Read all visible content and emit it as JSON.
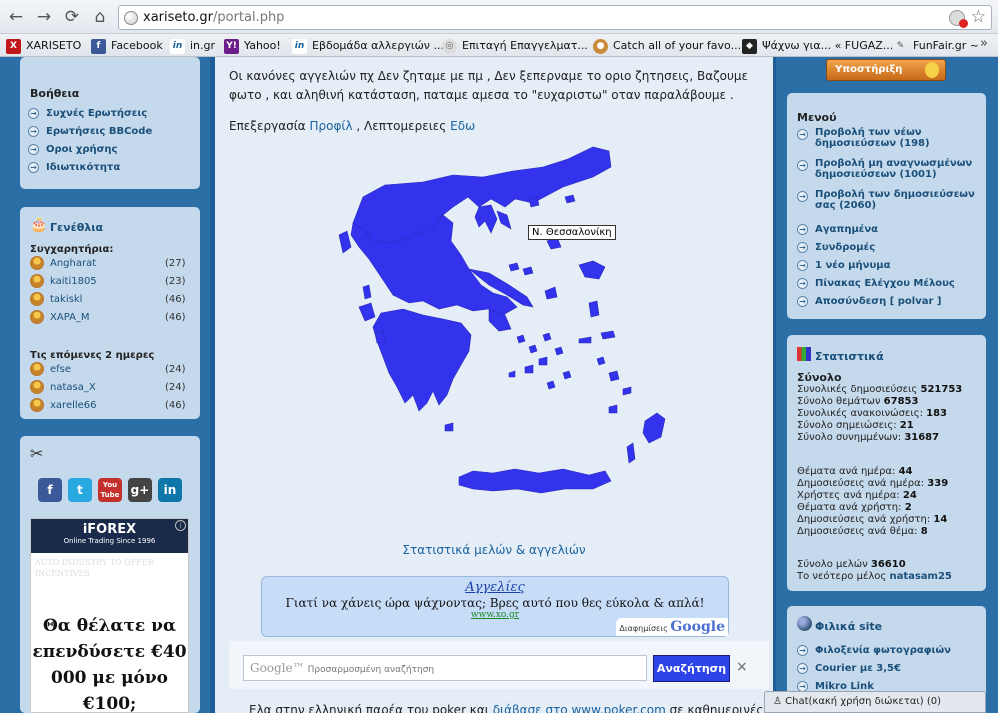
{
  "browser": {
    "url_host": "xariseto.gr",
    "url_path": "/portal.php",
    "bookmarks": [
      {
        "label": "XARISETO",
        "icon": "xariseto-icon"
      },
      {
        "label": "Facebook",
        "icon": "facebook-icon"
      },
      {
        "label": "in.gr",
        "icon": "in-gr-icon"
      },
      {
        "label": "Yahoo!",
        "icon": "yahoo-icon"
      },
      {
        "label": "Εβδομάδα αλλεργιών ...",
        "icon": "in-gr-icon"
      },
      {
        "label": "Επιταγή Επαγγελματ...",
        "icon": "globe-icon"
      },
      {
        "label": "Catch all of your favo...",
        "icon": "cookie-icon"
      },
      {
        "label": "Ψάχνω για... « FUGAZ...",
        "icon": "fugaz-icon"
      },
      {
        "label": "FunFair.gr ~",
        "icon": "funfair-icon"
      }
    ],
    "more": "»"
  },
  "left": {
    "help": {
      "title": "Βοήθεια",
      "items": [
        "Συχνές Ερωτήσεις",
        "Ερωτήσεις BBCode",
        "Οροι χρήσης",
        "Ιδιωτικότητα"
      ]
    },
    "birthdays": {
      "title": "Γενέθλια",
      "congrats_label": "Συγχαρητήρια:",
      "today": [
        {
          "name": "Angharat",
          "count": "(27)"
        },
        {
          "name": "kaiti1805",
          "count": "(23)"
        },
        {
          "name": "takiskl",
          "count": "(46)"
        },
        {
          "name": "XAPA_M",
          "count": "(46)"
        }
      ],
      "next_label": "Τις επόμενες 2 ημερες",
      "upcoming": [
        {
          "name": "efse",
          "count": "(24)"
        },
        {
          "name": "natasa_X",
          "count": "(24)"
        },
        {
          "name": "xarelle66",
          "count": "(46)"
        }
      ]
    },
    "social": [
      "f",
      "t",
      "You\nTube",
      "g+",
      "in"
    ],
    "ad": {
      "logo": "iFOREX",
      "tagline": "Online Trading Since 1996",
      "bg_text": "AUTO INDUSTRY TO OFFER INCENTIVES",
      "text": "Θα θέλατε να επενδύσετε €40 000 με μόνο €100;"
    }
  },
  "center": {
    "rules_text": "Οι κανόνες αγγελιών πχ Δεν ζηταμε με πμ , Δεν ξεπερναμε το οριο ζητησεις, Βαζουμε φωτο , και αληθινή κατάσταση, παταμε αμεσα το \"ευχαριστω\" οταν παραλάβουμε .",
    "edit_prefix": "Επεξεργασία",
    "edit_link1": "Προφίλ",
    "edit_sep": " , Λεπτομερειες",
    "edit_link2": "Εδω",
    "map_tooltip": "Ν. Θεσσαλονίκη",
    "stats_link": "Στατιστικά μελών & αγγελιών",
    "ad": {
      "title": "Αγγελίες",
      "text": "Γιατί να χάνεις ώρα ψάχνοντας; Βρες αυτό που θες εύκολα & απλά!",
      "url": "www.xo.gr",
      "credit_prefix": "Διαφημίσεις",
      "credit_brand": "Google"
    },
    "search": {
      "logo": "Google™",
      "placeholder": "Προσαρμοσμένη αναζήτηση",
      "button": "Αναζήτηση",
      "close": "×"
    },
    "bottom_text_prefix": "Ελα στην ελληνική παρέα του poker και",
    "bottom_link1": "διάβασε στο",
    "bottom_link2": "www.poker.com",
    "bottom_text_suffix": "σε καθημερινές"
  },
  "right": {
    "support_label": "Υποστήριξη",
    "menu": {
      "title": "Μενού",
      "items": [
        "Προβολή των νέων δημοσιεύσεων (198)",
        "Προβολή μη αναγνωσμένων δημοσιεύσεων (1001)",
        "Προβολή των δημοσιεύσεων σας (2060)",
        "Αγαπημένα",
        "Συνδρομές",
        "1 νέο μήνυμα",
        "Πίνακας Ελέγχου Μέλους",
        "Αποσύνδεση [ polvar ]"
      ]
    },
    "stats": {
      "title": "Στατιστικά",
      "total_label": "Σύνολο",
      "lines1": [
        {
          "label": "Συνολικές δημοσιεύσεις",
          "value": "521753"
        },
        {
          "label": "Σύνολο θεμάτων",
          "value": "67853"
        },
        {
          "label": "Συνολικές ανακοινώσεις:",
          "value": "183"
        },
        {
          "label": "Σύνολο σημειώσεις:",
          "value": "21"
        },
        {
          "label": "Σύνολο συνημμένων:",
          "value": "31687"
        }
      ],
      "lines2": [
        {
          "label": "Θέματα ανά ημέρα:",
          "value": "44"
        },
        {
          "label": "Δημοσιεύσεις ανά ημέρα:",
          "value": "339"
        },
        {
          "label": "Χρήστες ανά ημέρα:",
          "value": "24"
        },
        {
          "label": "Θέματα ανά χρήστη:",
          "value": "2"
        },
        {
          "label": "Δημοσιεύσεις ανά χρήστη:",
          "value": "14"
        },
        {
          "label": "Δημοσιεύσεις ανά θέμα:",
          "value": "8"
        }
      ],
      "members_label": "Σύνολο μελών",
      "members_value": "36610",
      "newest_label": "Το νεότερο μέλος",
      "newest_value": "natasam25"
    },
    "friends": {
      "title": "Φιλικά site",
      "items": [
        "Φιλοξενία φωτογραφιών",
        "Courier με 3,5€",
        "Mikro Link"
      ]
    },
    "chat_label": "Chat(κακή χρήση διώκεται)  (0)"
  }
}
